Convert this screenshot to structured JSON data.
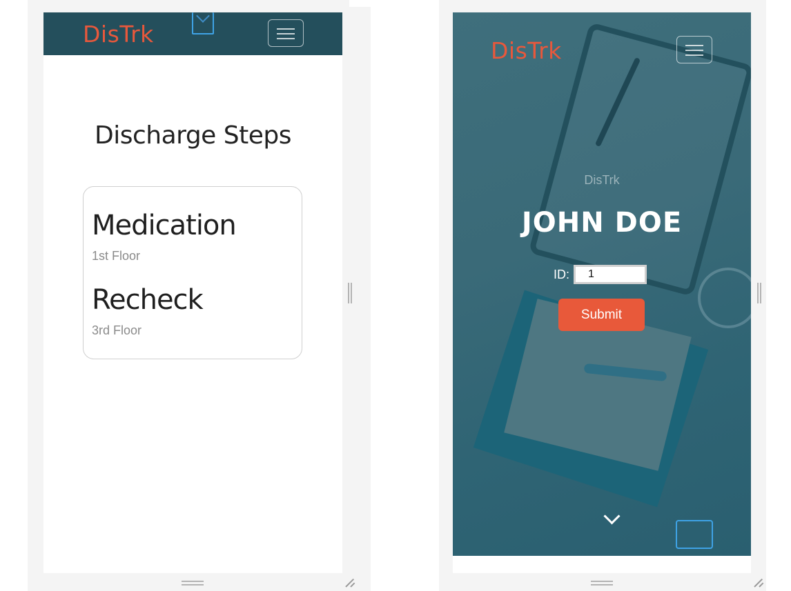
{
  "left_screen": {
    "brand": "DisTrk",
    "title": "Discharge Steps",
    "steps": [
      {
        "name": "Medication",
        "location": "1st Floor"
      },
      {
        "name": "Recheck",
        "location": "3rd Floor"
      }
    ]
  },
  "right_screen": {
    "brand": "DisTrk",
    "hero_brand": "DisTrk",
    "patient_name": "JOHN DOE",
    "id_label": "ID:",
    "id_value": "1",
    "submit_label": "Submit"
  },
  "colors": {
    "brand_orange": "#e8583c",
    "nav_teal": "#244f5c",
    "hero_teal": "#3a6a78",
    "submit_orange": "#e8593a",
    "focus_blue": "#3fa3e6"
  },
  "icons": {
    "menu": "hamburger-icon",
    "scroll_down": "chevron-down-icon",
    "resize_corner": "resize-grip-icon"
  }
}
